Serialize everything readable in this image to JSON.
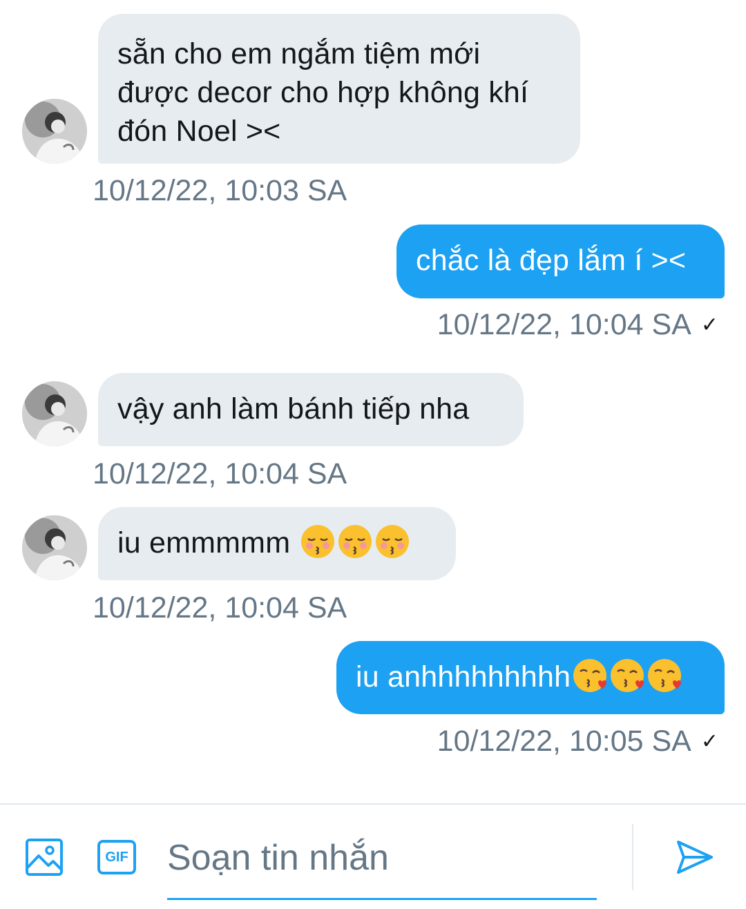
{
  "messages": [
    {
      "direction": "incoming",
      "lines": [
        "sẵn cho em ngắm tiệm mới",
        "được decor cho hợp không khí",
        "đón Noel ><"
      ],
      "timestamp": "10/12/22, 10:03 SA",
      "emoji": []
    },
    {
      "direction": "outgoing",
      "text": "chắc là đẹp lắm í ><",
      "timestamp": "10/12/22, 10:04 SA",
      "status": "✓",
      "emoji": []
    },
    {
      "direction": "incoming",
      "text": "vậy anh làm bánh tiếp nha",
      "timestamp": "10/12/22, 10:04 SA",
      "emoji": []
    },
    {
      "direction": "incoming",
      "text": "iu emmmmm ",
      "timestamp": "10/12/22, 10:04 SA",
      "emoji": [
        "kissing-closed-eyes",
        "kissing-closed-eyes",
        "kissing-closed-eyes"
      ]
    },
    {
      "direction": "outgoing",
      "text": "iu anhhhhhhhhh",
      "timestamp": "10/12/22, 10:05 SA",
      "status": "✓",
      "emoji": [
        "face-blowing-kiss",
        "face-blowing-kiss",
        "face-blowing-kiss"
      ]
    }
  ],
  "composer": {
    "placeholder": "Soạn tin nhắn",
    "image_icon": "image-icon",
    "gif_icon": "gif-icon",
    "gif_label": "GIF",
    "send_icon": "send-icon"
  },
  "colors": {
    "accent": "#1da1f2",
    "incoming_bubble": "#e6ecf0",
    "timestamp": "#657786"
  }
}
